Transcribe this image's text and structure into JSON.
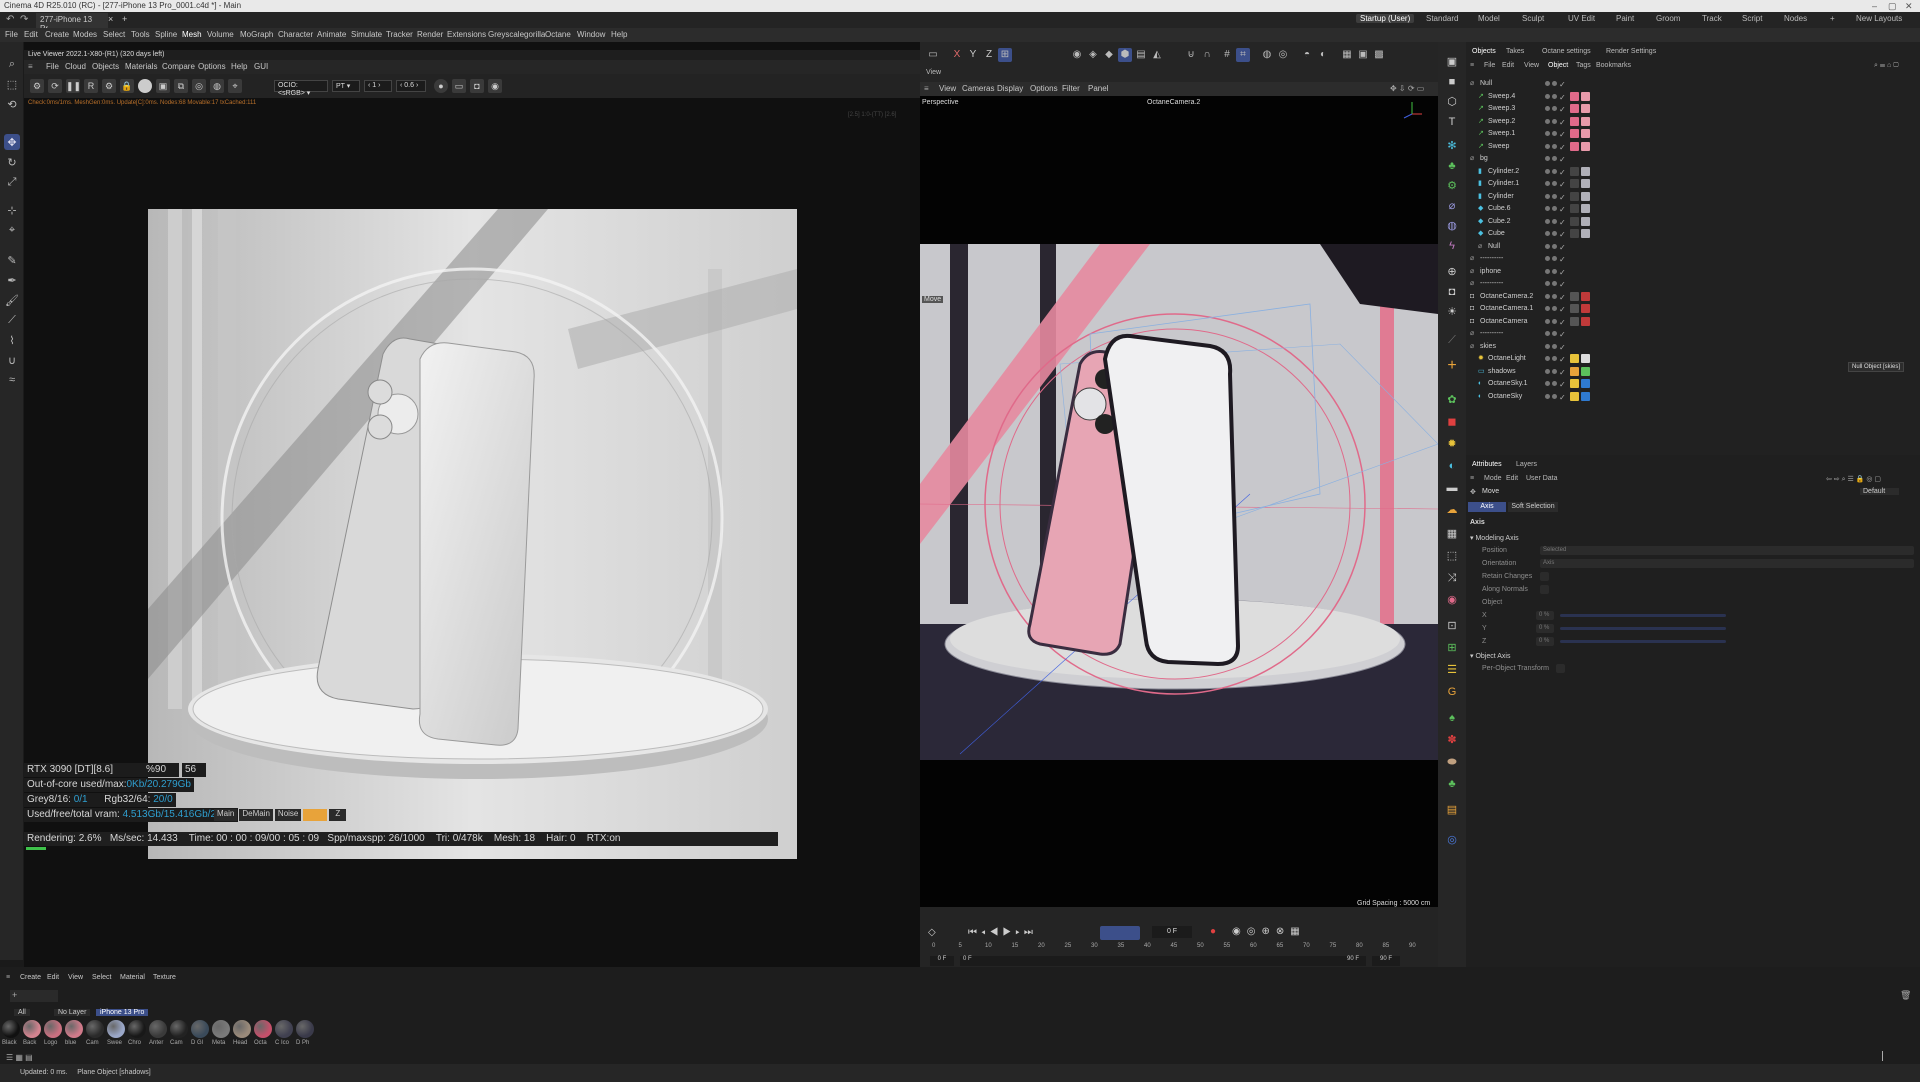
{
  "window": {
    "title": "Cinema 4D R25.010 (RC) - [277-iPhone 13 Pro_0001.c4d *] - Main"
  },
  "doc_tab": {
    "label": "277-iPhone 13 Pr...",
    "close": "×",
    "add": "+"
  },
  "layouts": {
    "items": [
      "Startup (User)",
      "Standard",
      "Model",
      "Sculpt",
      "UV Edit",
      "Paint",
      "Groom",
      "Track",
      "Script",
      "Nodes"
    ],
    "active": "Startup (User)",
    "add": "+",
    "new_layouts": "New Layouts"
  },
  "menu": [
    "File",
    "Edit",
    "Create",
    "Modes",
    "Select",
    "Tools",
    "Spline",
    "Mesh",
    "Volume",
    "MoGraph",
    "Character",
    "Animate",
    "Simulate",
    "Tracker",
    "Render",
    "Extensions",
    "Greyscalegorilla",
    "Octane",
    "Window",
    "Help"
  ],
  "live_viewer": {
    "title": "Live Viewer 2022.1-X80-(R1) (320 days left)",
    "menu": [
      "File",
      "Cloud",
      "Objects",
      "Materials",
      "Compare",
      "Options",
      "Help",
      "GUI"
    ],
    "colorspace": "OCIO:<sRGB>",
    "mode": "PT",
    "frame": "1",
    "zoom": "0.6",
    "status_text": "Check:0ms/1ms. MeshGen:0ms. Update[C]:0ms. Nodes:68 Movable:17 txCached:111",
    "right_text": "[2.5] 1:0-(TT) [2.6]",
    "stats": {
      "gpu": "RTX 3090 [DT][8.6]",
      "pct": "%90",
      "temp": "56",
      "ooc_label": "Out-of-core used/max:",
      "ooc_value": "0Kb/20.279Gb",
      "grey_label": "Grey8/16:",
      "grey_value": "0/1",
      "rgb_label": "Rgb32/64:",
      "rgb_value": "20/0",
      "vram_label": "Used/free/total vram:",
      "vram_value": "4.513Gb/15.416Gb/24Gb",
      "main": "Main",
      "denoise": "DeMain",
      "noise": "Noise",
      "z": "Z",
      "rendering_label": "Rendering:",
      "rendering_value": "2.6%",
      "mss_label": "Ms/sec:",
      "mss_value": "14.433",
      "time_label": "Time:",
      "time_value": "00 : 00 : 09/00 : 05 : 09",
      "spp_label": "Spp/maxspp:",
      "spp_value": "26/1000",
      "tri_label": "Tri:",
      "tri_value": "0/478k",
      "mesh_label": "Mesh:",
      "mesh_value": "18",
      "hair_label": "Hair:",
      "hair_value": "0",
      "rtx_label": "RTX:",
      "rtx_value": "on"
    }
  },
  "viewport": {
    "tab": "View",
    "menu": [
      "View",
      "Cameras",
      "Display",
      "Options",
      "Filter",
      "Panel"
    ],
    "projection": "Perspective",
    "camera": "OctaneCamera.2",
    "move_label": "Move",
    "grid_spacing": "Grid Spacing : 5000 cm",
    "axis_x": "X",
    "axis_y": "Y",
    "axis_z": "Z"
  },
  "timeline": {
    "current_frame": "0 F",
    "ticks": [
      "0",
      "5",
      "10",
      "15",
      "20",
      "25",
      "30",
      "35",
      "40",
      "45",
      "50",
      "55",
      "60",
      "65",
      "70",
      "75",
      "80",
      "85",
      "90"
    ],
    "start": "0 F",
    "start2": "0 F",
    "end": "90 F",
    "end2": "90 F"
  },
  "objects_panel": {
    "tabs": [
      "Objects",
      "Takes",
      "Octane settings",
      "Render Settings"
    ],
    "menu": [
      "File",
      "Edit",
      "View",
      "Object",
      "Tags",
      "Bookmarks"
    ],
    "items": [
      {
        "name": "Null",
        "indent": 0,
        "icon": "null-icon"
      },
      {
        "name": "Sweep.4",
        "indent": 1,
        "icon": "sweep-icon"
      },
      {
        "name": "Sweep.3",
        "indent": 1,
        "icon": "sweep-icon"
      },
      {
        "name": "Sweep.2",
        "indent": 1,
        "icon": "sweep-icon"
      },
      {
        "name": "Sweep.1",
        "indent": 1,
        "icon": "sweep-icon"
      },
      {
        "name": "Sweep",
        "indent": 1,
        "icon": "sweep-icon"
      },
      {
        "name": "bg",
        "indent": 0,
        "icon": "null-icon"
      },
      {
        "name": "Cylinder.2",
        "indent": 1,
        "icon": "cylinder-icon"
      },
      {
        "name": "Cylinder.1",
        "indent": 1,
        "icon": "cylinder-icon"
      },
      {
        "name": "Cylinder",
        "indent": 1,
        "icon": "cylinder-icon"
      },
      {
        "name": "Cube.6",
        "indent": 1,
        "icon": "cube-icon"
      },
      {
        "name": "Cube.2",
        "indent": 1,
        "icon": "cube-icon"
      },
      {
        "name": "Cube",
        "indent": 1,
        "icon": "cube-icon"
      },
      {
        "name": "Null",
        "indent": 1,
        "icon": "null-icon"
      },
      {
        "name": "----------",
        "indent": 0,
        "icon": "null-icon"
      },
      {
        "name": "iphone",
        "indent": 0,
        "icon": "null-icon"
      },
      {
        "name": "----------",
        "indent": 0,
        "icon": "null-icon"
      },
      {
        "name": "OctaneCamera.2",
        "indent": 0,
        "icon": "camera-icon"
      },
      {
        "name": "OctaneCamera.1",
        "indent": 0,
        "icon": "camera-icon"
      },
      {
        "name": "OctaneCamera",
        "indent": 0,
        "icon": "camera-icon"
      },
      {
        "name": "----------",
        "indent": 0,
        "icon": "null-icon"
      },
      {
        "name": "skies",
        "indent": 0,
        "icon": "null-icon"
      },
      {
        "name": "OctaneLight",
        "indent": 1,
        "icon": "light-icon"
      },
      {
        "name": "shadows",
        "indent": 1,
        "icon": "plane-icon"
      },
      {
        "name": "OctaneSky.1",
        "indent": 1,
        "icon": "sky-icon"
      },
      {
        "name": "OctaneSky",
        "indent": 1,
        "icon": "sky-icon"
      }
    ],
    "tooltip": "Null Object [skies]"
  },
  "attributes": {
    "tabs": [
      "Attributes",
      "Layers"
    ],
    "menu": [
      "Mode",
      "Edit",
      "User Data"
    ],
    "tool": "Move",
    "preset": "Default",
    "subtabs": [
      "Axis",
      "Soft Selection"
    ],
    "section": "Axis",
    "group1": "Modeling Axis",
    "position_label": "Position",
    "position_value": "Selected",
    "orientation_label": "Orientation",
    "orientation_value": "Axis",
    "retain_label": "Retain Changes",
    "along_label": "Along Normals",
    "object_label": "Object",
    "x_label": "X",
    "y_label": "Y",
    "z_label": "Z",
    "pct": "0 %",
    "group2": "Object Axis",
    "per_object_label": "Per-Object Transform"
  },
  "material_manager": {
    "menu": [
      "Create",
      "Edit",
      "View",
      "Select",
      "Material",
      "Texture"
    ],
    "filters": [
      "All",
      "No Layer",
      "iPhone 13 Pro"
    ],
    "materials": [
      {
        "label": "Black",
        "color": "#111111"
      },
      {
        "label": "Back",
        "color": "#d2838f"
      },
      {
        "label": "Logo",
        "color": "#c97080"
      },
      {
        "label": "blue",
        "color": "#d07a8a"
      },
      {
        "label": "Cam",
        "color": "#2a2a2a"
      },
      {
        "label": "Swee",
        "color": "#9aa7c8"
      },
      {
        "label": "Chro",
        "color": "#181818"
      },
      {
        "label": "Anter",
        "color": "#3a3a3a"
      },
      {
        "label": "Cam",
        "color": "#222222"
      },
      {
        "label": "D Gl",
        "color": "#3a4a5a"
      },
      {
        "label": "Meta",
        "color": "#7a7a7a"
      },
      {
        "label": "Head",
        "color": "#9a8a7a"
      },
      {
        "label": "Octa",
        "color": "#c4506a"
      },
      {
        "label": "C Ico",
        "color": "#404050"
      },
      {
        "label": "D Ph",
        "color": "#3a3a4a"
      }
    ]
  },
  "status": {
    "updated": "Updated: 0 ms.",
    "message": "Plane Object [shadows]"
  },
  "colors": {
    "accent": "#3c4f8a",
    "orange": "#e8a33a",
    "pink": "#e06a8a"
  }
}
